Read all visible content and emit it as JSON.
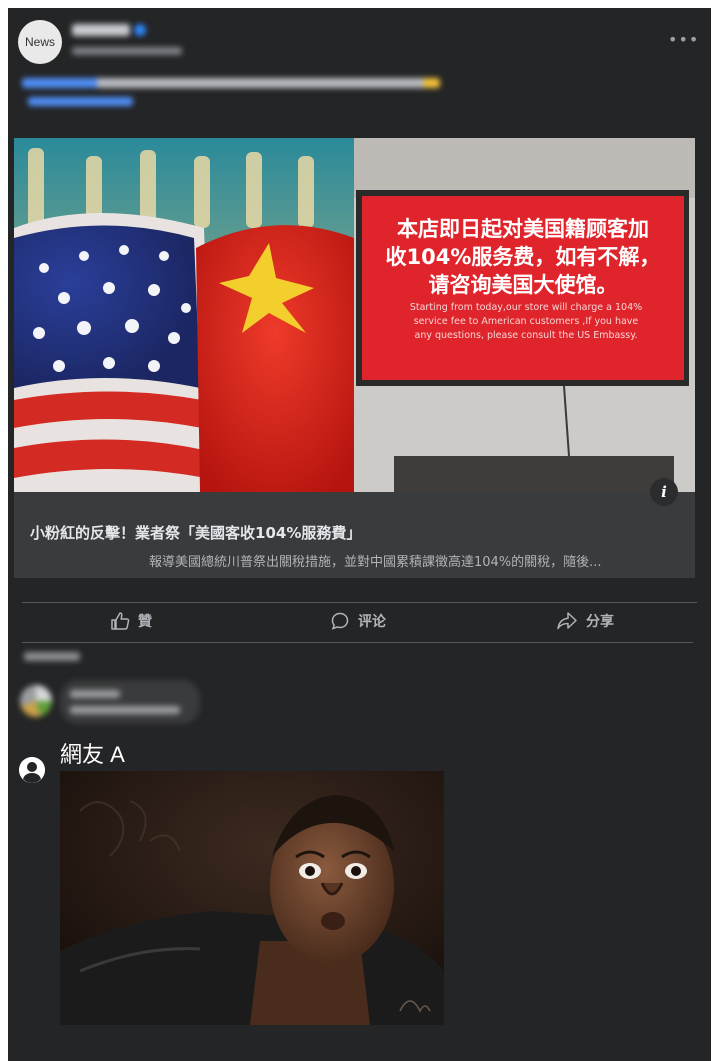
{
  "header": {
    "avatar_label": "News"
  },
  "link_card": {
    "photo": {
      "sign_text_zh_line1": "本店即日起对美国籍顾客加",
      "sign_text_zh_line2": "收104%服务费，如有不解，",
      "sign_text_zh_line3": "请咨询美国大使馆。",
      "sign_text_en_line1": "Starting from today,our store will charge a 104%",
      "sign_text_en_line2": "service fee to American customers ,If you have",
      "sign_text_en_line3": "any questions, please consult the US Embassy."
    },
    "info_icon": "info-icon",
    "title": "小粉紅的反擊！業者祭「美國客收104%服務費」",
    "description": "報導美國總統川普祭出關稅措施，並對中國累積課徵高達104%的關稅，隨後..."
  },
  "actions": {
    "like_label": "贊",
    "comment_label": "评论",
    "share_label": "分享"
  },
  "comment": {
    "author": "網友 A"
  },
  "colors": {
    "panel": "#242526",
    "card": "#3a3b3c",
    "sign_red": "#e0242b"
  }
}
